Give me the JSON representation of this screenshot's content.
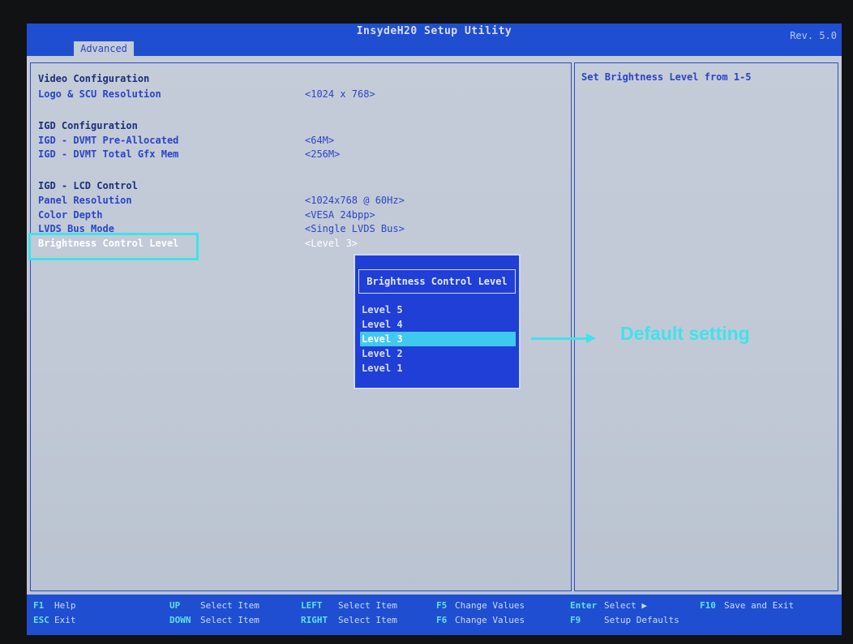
{
  "header": {
    "title": "InsydeH20 Setup Utility",
    "revision": "Rev. 5.0",
    "active_tab": "Advanced"
  },
  "main": {
    "video_config_heading": "Video Configuration",
    "logo_scu_label": "Logo & SCU Resolution",
    "logo_scu_value": "<1024 x 768>",
    "igd_config_heading": "IGD Configuration",
    "dvmt_prealloc_label": "IGD - DVMT Pre-Allocated",
    "dvmt_prealloc_value": "<64M>",
    "dvmt_total_label": "IGD - DVMT Total Gfx Mem",
    "dvmt_total_value": "<256M>",
    "lcd_control_heading": "IGD - LCD Control",
    "panel_res_label": "Panel Resolution",
    "panel_res_value": "<1024x768 @ 60Hz>",
    "color_depth_label": "Color Depth",
    "color_depth_value": "<VESA 24bpp>",
    "lvds_bus_label": "LVDS Bus Mode",
    "lvds_bus_value": "<Single LVDS Bus>",
    "brightness_label": "Brightness Control Level",
    "brightness_value": "<Level 3>"
  },
  "help": {
    "text": "Set Brightness Level from 1-5"
  },
  "popup": {
    "title": "Brightness Control Level",
    "options": [
      "Level 5",
      "Level 4",
      "Level 3",
      "Level 2",
      "Level 1"
    ],
    "selected": "Level 3"
  },
  "annotation": {
    "text": "Default setting"
  },
  "footer": {
    "f1_key": "F1",
    "f1_desc": "Help",
    "esc_key": "ESC",
    "esc_desc": "Exit",
    "up_key": "UP",
    "up_desc": "Select Item",
    "down_key": "DOWN",
    "down_desc": "Select Item",
    "left_key": "LEFT",
    "left_desc": "Select Item",
    "right_key": "RIGHT",
    "right_desc": "Select Item",
    "f5_key": "F5",
    "f5_desc": "Change Values",
    "f6_key": "F6",
    "f6_desc": "Change Values",
    "enter_key": "Enter",
    "enter_desc": "Select ▶",
    "f9_key": "F9",
    "f9_desc": "Setup Defaults",
    "f10_key": "F10",
    "f10_desc": "Save and Exit"
  },
  "colors": {
    "bios_blue": "#1f4fd0",
    "screen_bg": "#c4ccd9",
    "annotation_cyan": "#3fe3ea",
    "highlight": "#3fc9ee"
  }
}
